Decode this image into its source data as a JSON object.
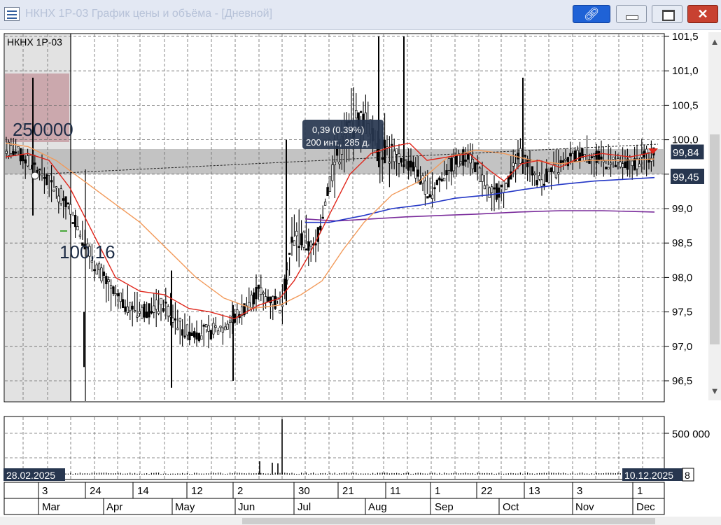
{
  "window": {
    "title": "НКНХ 1Р-03 График цены и объёма - [Дневной]",
    "link_icon": "link-icon",
    "buttons": [
      "minimize",
      "maximize",
      "close"
    ]
  },
  "chart": {
    "instrument_label": "НКНХ 1Р-03",
    "y_axis_labels": [
      "101,5",
      "101,0",
      "100,5",
      "100,0",
      "99,5",
      "99,0",
      "98,5",
      "98,0",
      "97,5",
      "97,0",
      "96,5"
    ],
    "current_price_badge": "99,84",
    "level_badge": "99,45",
    "tooltip_line1": "0,39 (0.39%)",
    "tooltip_line2": "200 инт., 285 д.",
    "overlay_volume_text": "250000",
    "overlay_price_text": "100,16",
    "accent_colors": {
      "red_ma": "#e0261b",
      "orange_ma": "#f29a5a",
      "blue_ma": "#2437c6",
      "purple_ma": "#7a2c9b",
      "badge_bg": "#27364f"
    }
  },
  "volume": {
    "y_axis_label": "500 000",
    "start_date": "28.02.2025",
    "end_date": "10.12.2025",
    "end_trailing": "8"
  },
  "timeline": {
    "day_ticks": [
      "3",
      "24",
      "14",
      "12",
      "2",
      "30",
      "21",
      "11",
      "1",
      "22",
      "13",
      "3",
      "1"
    ],
    "months": [
      "Mar",
      "Apr",
      "May",
      "Jun",
      "Jul",
      "Aug",
      "Sep",
      "Oct",
      "Nov",
      "Dec"
    ]
  }
}
